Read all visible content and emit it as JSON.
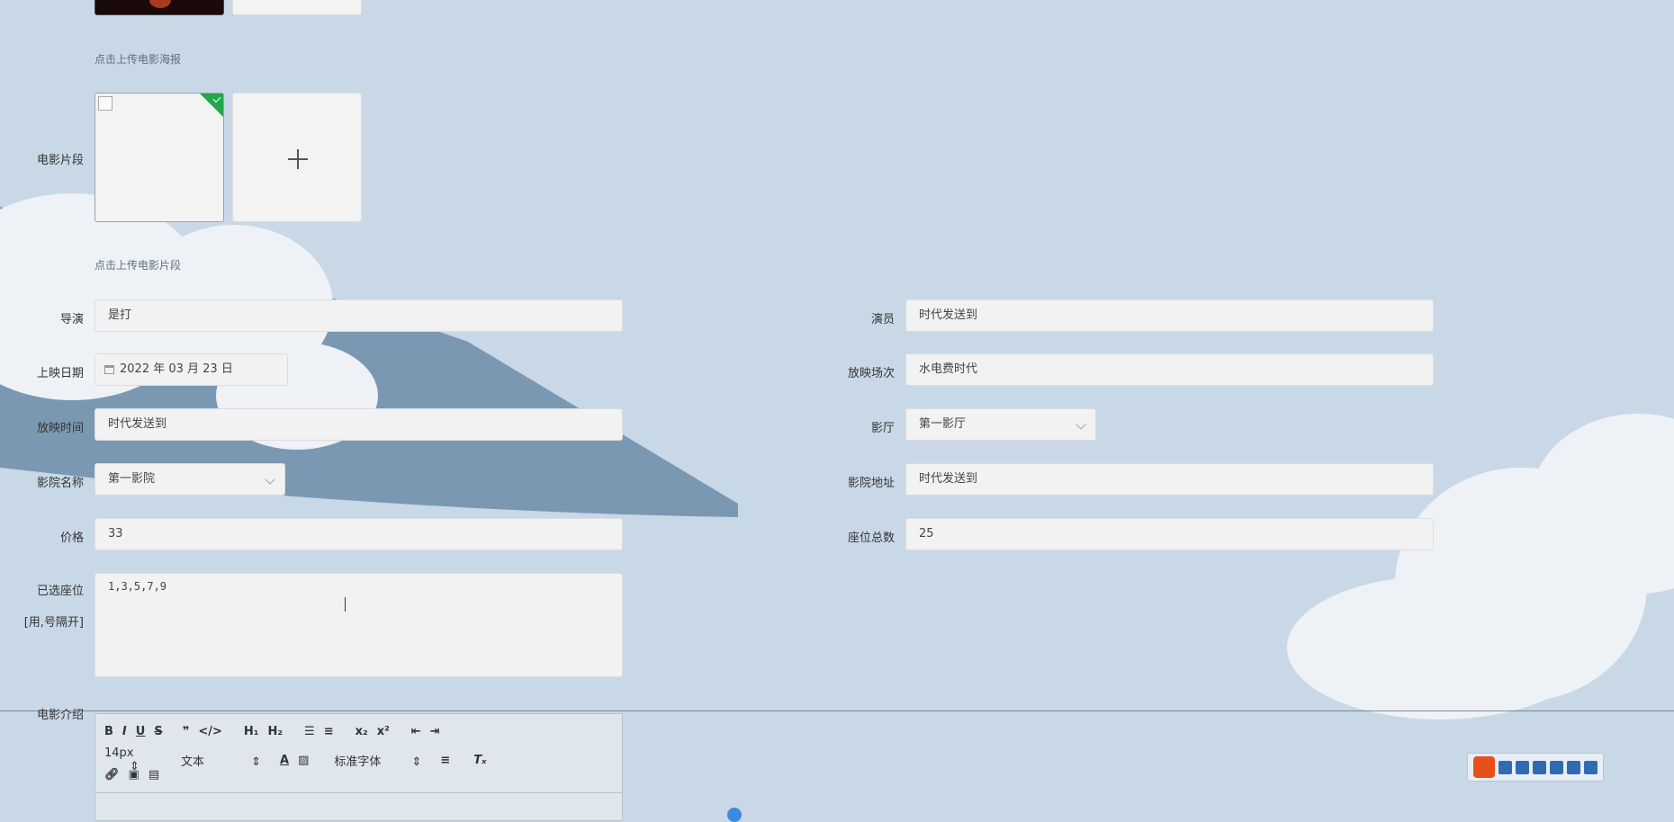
{
  "form": {
    "poster_hint": "点击上传电影海报",
    "clip_label": "电影片段",
    "clip_hint": "点击上传电影片段",
    "director": {
      "label": "导演",
      "value": "是打"
    },
    "actors": {
      "label": "演员",
      "value": "时代发送到"
    },
    "release_date": {
      "label": "上映日期",
      "value": "2022 年 03 月 23 日"
    },
    "screening_session": {
      "label": "放映场次",
      "value": "水电费时代"
    },
    "screening_time": {
      "label": "放映时间",
      "value": "时代发送到"
    },
    "hall": {
      "label": "影厅",
      "value": "第一影厅"
    },
    "cinema_name": {
      "label": "影院名称",
      "value": "第一影院"
    },
    "cinema_address": {
      "label": "影院地址",
      "value": "时代发送到"
    },
    "price": {
      "label": "价格",
      "value": "33"
    },
    "total_seats": {
      "label": "座位总数",
      "value": "25"
    },
    "selected_seats": {
      "label_line1": "已选座位",
      "label_line2": "[用,号隔开]",
      "value": "1,3,5,7,9"
    },
    "intro_label": "电影介绍"
  },
  "editor": {
    "font_size": "14px",
    "block_type": "文本",
    "font_family": "标准字体"
  },
  "colors": {
    "background": "#c9d8e6",
    "check_badge": "#22a84a"
  }
}
